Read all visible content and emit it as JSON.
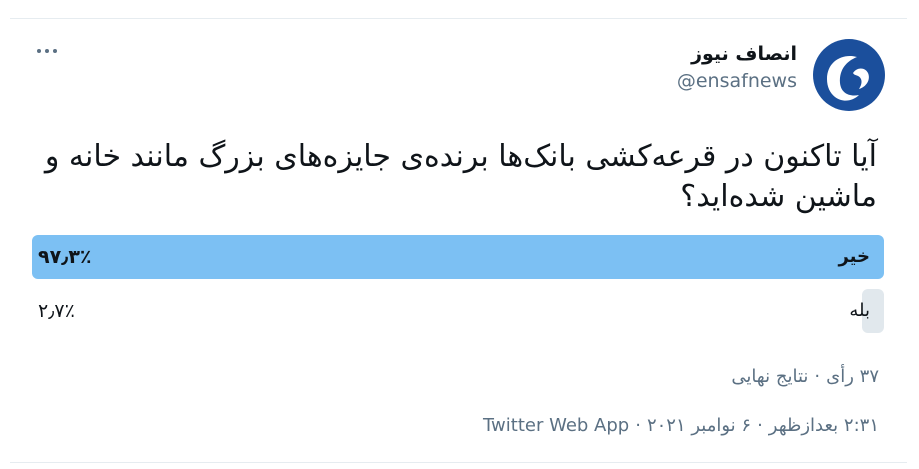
{
  "account": {
    "name": "انصاف نیوز",
    "handle": "@ensafnews"
  },
  "tweet": {
    "text": "آیا تاکنون در قرعه‌کشی بانک‌ها برنده‌ی جایزه‌های بزرگ مانند خانه و ماشین شده‌اید؟"
  },
  "poll": {
    "options": [
      {
        "label": "خیر",
        "percent_text": "۹۷٫۳٪",
        "percent": 97.3
      },
      {
        "label": "بله",
        "percent_text": "۲٫۷٪",
        "percent": 2.7
      }
    ],
    "votes": "۳۷ رأی",
    "status": "نتایج نهایی"
  },
  "meta": {
    "time": "۲:۳۱ بعدازظهر",
    "date": "۶ نوامبر ۲۰۲۱",
    "source": "Twitter Web App",
    "separator": "·"
  },
  "colors": {
    "winner_bar": "#7cc0f3",
    "loser_bar": "#e1e8ed",
    "secondary_text": "#5b7083",
    "brand": "#1b4f9c"
  }
}
